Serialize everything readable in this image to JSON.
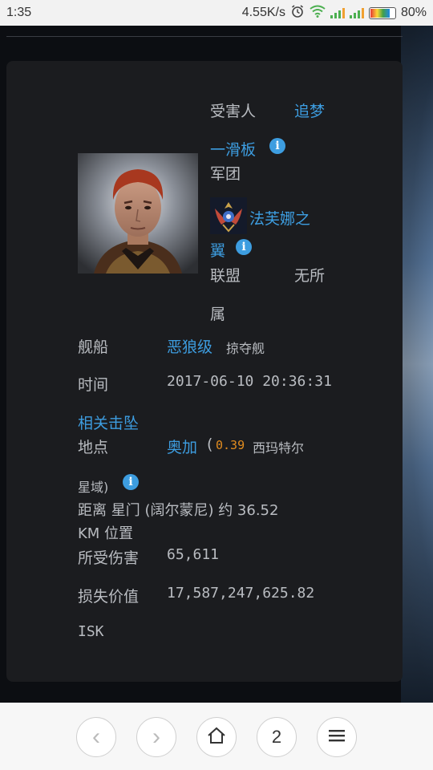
{
  "status_bar": {
    "time": "1:35",
    "network_speed": "4.55K/s",
    "battery": "80%",
    "battery_level": 0.8
  },
  "victim": {
    "label": "受害人",
    "name": "追梦",
    "corp_name": "一滑板",
    "corp_label": "军团",
    "alliance_name_line1": "法芙娜之",
    "alliance_name_line2": "翼",
    "alliance_label": "联盟",
    "alliance_value_line1": "无所",
    "alliance_value_line2": "属"
  },
  "details": {
    "ship_label": "舰船",
    "ship_name": "恶狼级",
    "ship_class": "掠夺舰",
    "time_label": "时间",
    "time_value": "2017-06-10 20:36:31",
    "related_kills": "相关击坠",
    "location_label": "地点",
    "location_system": "奥加",
    "location_open_paren": "(",
    "location_security": "0.39",
    "location_region": "西玛特尔",
    "location_region_suffix": "星域)",
    "distance_line1": "距离 星门 (阔尔蒙尼) 约 36.52",
    "distance_line2": "KM 位置",
    "damage_label": "所受伤害",
    "damage_value": "65,611",
    "loss_label": "损失价值",
    "loss_value": "17,587,247,625.82",
    "loss_unit": "ISK"
  },
  "browser": {
    "back_icon": "‹",
    "forward_icon": "›",
    "tabs_count": "2"
  },
  "colors": {
    "link": "#3d9de0",
    "security": "#e28c1f",
    "text": "#b9bcc1",
    "card": "#1b1c1f"
  }
}
